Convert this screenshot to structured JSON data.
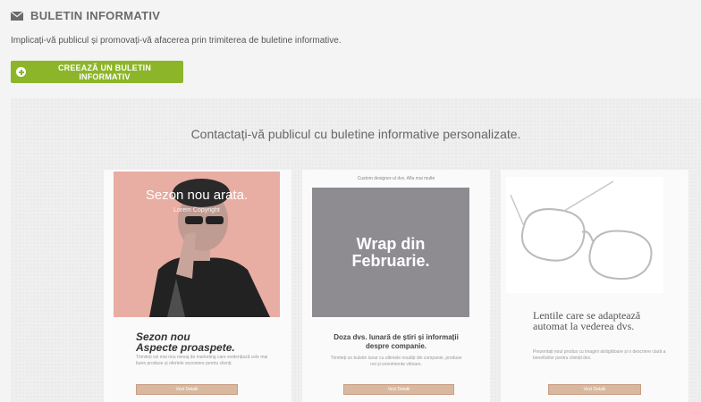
{
  "header": {
    "title": "BULETIN INFORMATIV",
    "icon": "envelope-icon"
  },
  "description": "Implicați-vă publicul și promovați-vă afacerea prin trimiterea de buletine informative.",
  "cta": {
    "label": "CREEAZĂ UN BULETIN INFORMATIV",
    "color": "#8cb52a"
  },
  "panel": {
    "heading": "Contactați-vă publicul cu buletine informative personalizate.",
    "cards": [
      {
        "image_title": "Sezon nou arata.",
        "image_subtitle": "Lorem Copyright",
        "title": "Sezon nou\nAspecte proaspete.",
        "body": "Trimiteți cel mai nou mesaj de marketing care evidențiază cele mai bune produse și ofertele sezoniere pentru clienți.",
        "button": "Vezi Detalii"
      },
      {
        "top_note": "Custom designer-ul dvs. Afla mai multe",
        "image_title": "Wrap din Februarie.",
        "title": "Doza dvs. lunară de știri și informații despre companie.",
        "body": "Trimiteți un buletin lunar cu ultimele noutăți din companie, produse noi și evenimente viitoare.",
        "button": "Vezi Detalii"
      },
      {
        "image_alt": "glasses-illustration",
        "title": "Lentile care se adaptează automat la vederea dvs.",
        "body": "Prezentați noul produs cu imagini atrăgătoare și o descriere clară a beneficiilor pentru clienții dvs.",
        "button": "Vezi Detalii"
      }
    ]
  }
}
